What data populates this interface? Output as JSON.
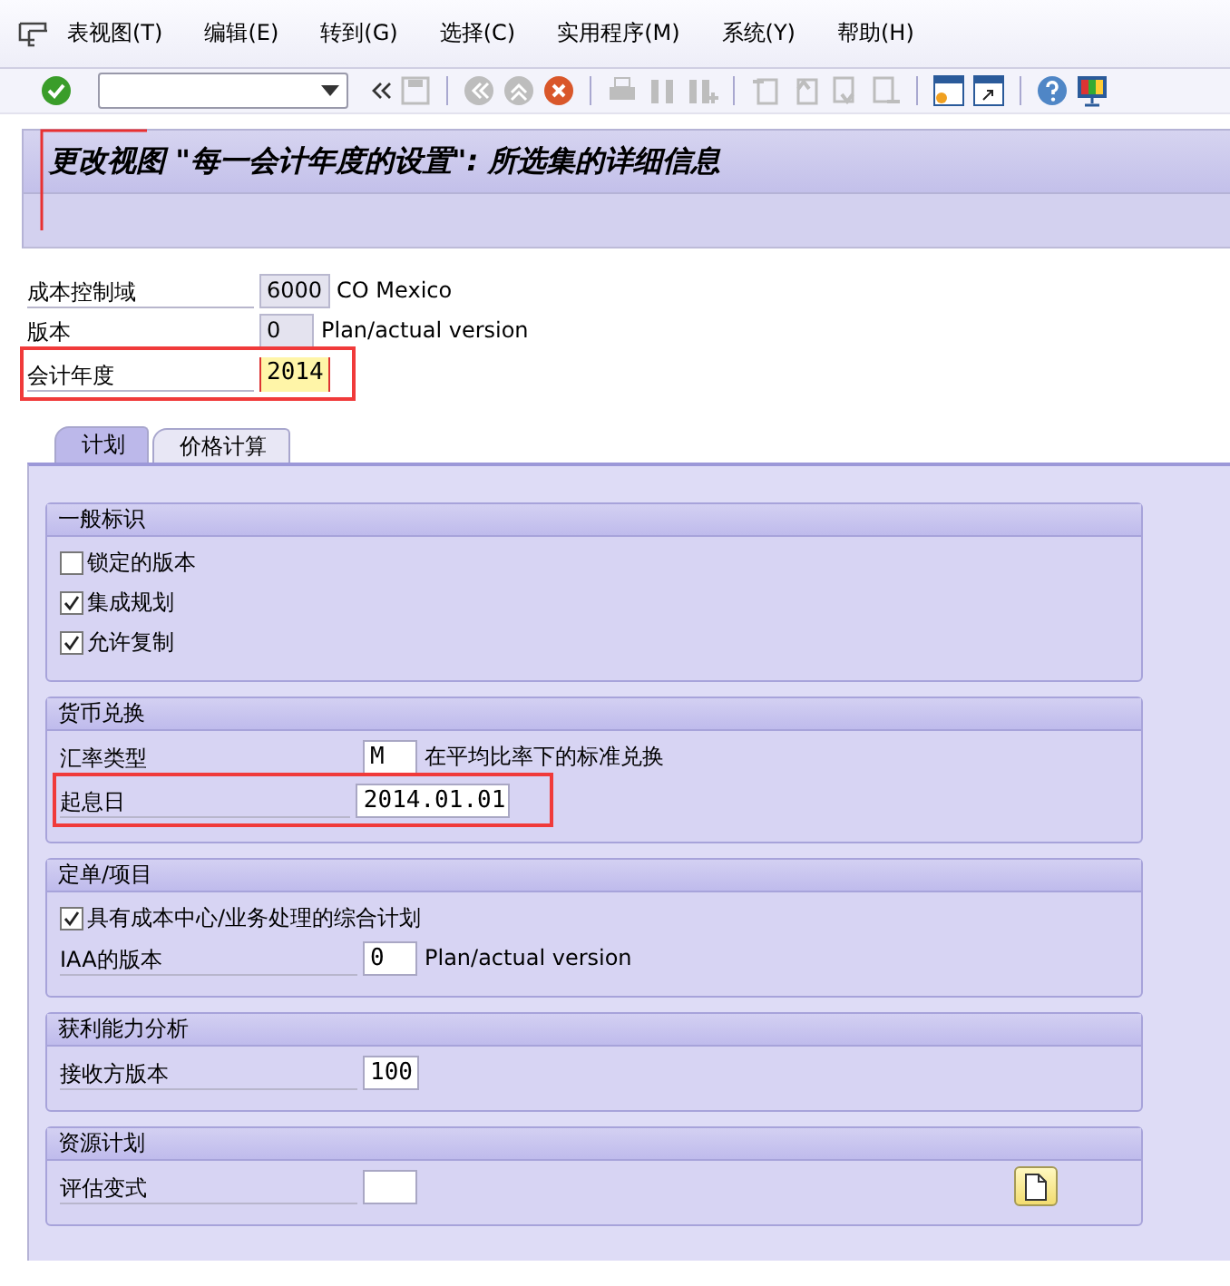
{
  "menu": [
    "表视图(T)",
    "编辑(E)",
    "转到(G)",
    "选择(C)",
    "实用程序(M)",
    "系统(Y)",
    "帮助(H)"
  ],
  "title": "更改视图 \"每一会计年度的设置\": 所选集的详细信息",
  "title_marker": true,
  "header_fields": [
    {
      "label": "成本控制域",
      "value": "6000",
      "description": "CO Mexico",
      "editable": false,
      "focused": false,
      "highlighted": false
    },
    {
      "label": "版本",
      "value": "0",
      "description": "Plan/actual version",
      "editable": false,
      "focused": false,
      "highlighted": false
    },
    {
      "label": "会计年度",
      "value": "2014",
      "editable": true,
      "focused": true,
      "highlighted": true
    }
  ],
  "tabs": [
    {
      "label": "计划",
      "selected": true
    },
    {
      "label": "价格计算",
      "selected": false
    }
  ],
  "groups": [
    {
      "title": "一般标识",
      "rows": [
        {
          "kind": "checkbox",
          "label": "锁定的版本",
          "checked": false
        },
        {
          "kind": "checkbox",
          "label": "集成规划",
          "checked": true
        },
        {
          "kind": "checkbox",
          "label": "允许复制",
          "checked": true
        }
      ]
    },
    {
      "title": "货币兑换",
      "rows": [
        {
          "kind": "field",
          "label": "汇率类型",
          "value": "M",
          "description": "在平均比率下的标准兑换",
          "highlighted": false
        },
        {
          "kind": "field",
          "label": "起息日",
          "value": "2014.01.01",
          "highlighted": true
        }
      ]
    },
    {
      "title": "定单/项目",
      "rows": [
        {
          "kind": "checkbox",
          "label": "具有成本中心/业务处理的综合计划",
          "checked": true
        },
        {
          "kind": "field",
          "label": "IAA的版本",
          "value": "0",
          "description": "Plan/actual version",
          "highlighted": false
        }
      ]
    },
    {
      "title": "获利能力分析",
      "rows": [
        {
          "kind": "field",
          "label": "接收方版本",
          "value": "100",
          "highlighted": false
        }
      ]
    },
    {
      "title": "资源计划",
      "rows": [
        {
          "kind": "field",
          "label": "评估变式",
          "value": "",
          "highlighted": false,
          "detail_button": true
        }
      ]
    }
  ]
}
